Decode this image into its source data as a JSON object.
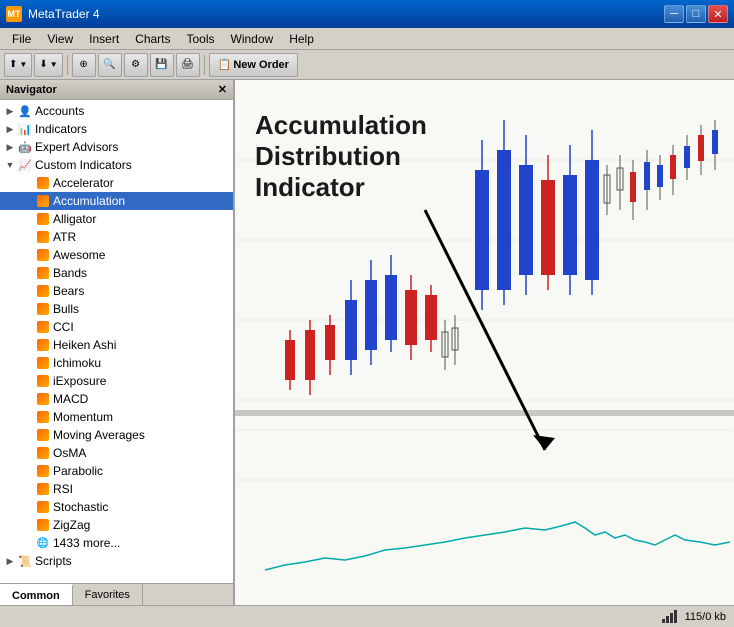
{
  "titleBar": {
    "title": "MetaTrader 4",
    "icon": "MT",
    "controls": [
      "minimize",
      "maximize",
      "close"
    ]
  },
  "menuBar": {
    "items": [
      "File",
      "View",
      "Insert",
      "Charts",
      "Tools",
      "Window",
      "Help"
    ]
  },
  "toolbar": {
    "newOrderLabel": "New Order",
    "buttons": [
      "arrow-left",
      "arrow-right",
      "zoom-in",
      "zoom-out",
      "crosshair",
      "properties"
    ]
  },
  "navigator": {
    "title": "Navigator",
    "tabs": [
      "Common",
      "Favorites"
    ],
    "tree": {
      "accounts": {
        "label": "Accounts",
        "expanded": true
      },
      "indicators": {
        "label": "Indicators",
        "expanded": false
      },
      "expertAdvisors": {
        "label": "Expert Advisors",
        "expanded": false
      },
      "customIndicators": {
        "label": "Custom Indicators",
        "expanded": true,
        "items": [
          "Accelerator",
          "Accumulation",
          "Alligator",
          "ATR",
          "Awesome",
          "Bands",
          "Bears",
          "Bulls",
          "CCI",
          "Heiken Ashi",
          "Ichimoku",
          "iExposure",
          "MACD",
          "Momentum",
          "Moving Averages",
          "OsMA",
          "Parabolic",
          "RSI",
          "Stochastic",
          "ZigZag",
          "1433 more..."
        ]
      },
      "scripts": {
        "label": "Scripts",
        "expanded": false
      }
    }
  },
  "chart": {
    "annotation": {
      "line1": "Accumulation",
      "line2": "Distribution",
      "line3": "Indicator"
    }
  },
  "statusBar": {
    "memory": "115/0 kb"
  }
}
